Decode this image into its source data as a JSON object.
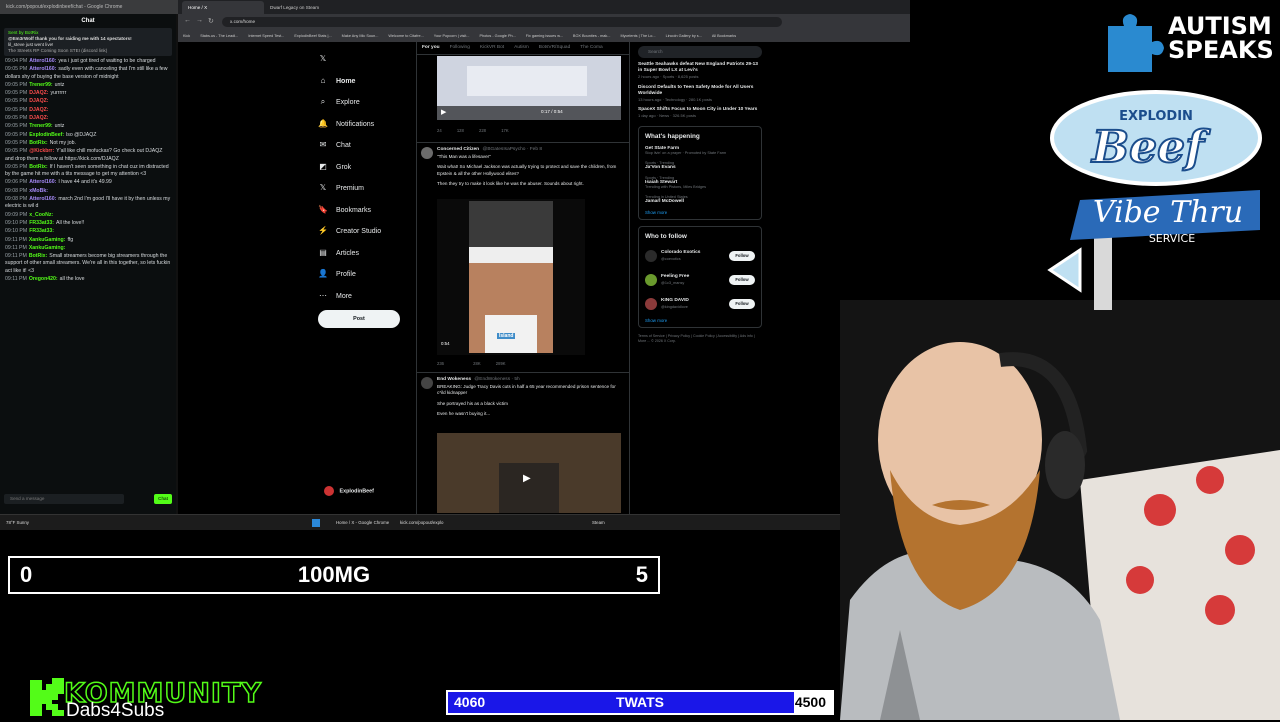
{
  "browser_left": {
    "title": "kick.com/popout/explodinbeef/chat - Google Chrome"
  },
  "chat": {
    "header": "Chat",
    "pinned_lines": [
      "Sent by BotRix",
      "@Em3rWolf thank you for raiding me with 14 spectators!",
      "lil_steve just went live!",
      "The Streets RP Coming Soon STEI (discord link)"
    ],
    "messages": [
      {
        "time": "09:04 PM",
        "user": "Atterol160:",
        "color": "#a78bfa",
        "text": "yea i just got tired of waiting to be charged"
      },
      {
        "time": "09:05 PM",
        "user": "Atterol160:",
        "color": "#a78bfa",
        "text": "sadly even with canceling that I'm still like a few dollars shy of buying the base version of midnight"
      },
      {
        "time": "09:05 PM",
        "user": "Trener99:",
        "color": "#53fc18",
        "text": "untz"
      },
      {
        "time": "09:05 PM",
        "user": "DJAQZ:",
        "color": "#ff4d4d",
        "text": "yurrrrrr"
      },
      {
        "time": "09:05 PM",
        "user": "DJAQZ:",
        "color": "#ff4d4d",
        "text": ""
      },
      {
        "time": "09:05 PM",
        "user": "DJAQZ:",
        "color": "#ff4d4d",
        "text": ""
      },
      {
        "time": "09:05 PM",
        "user": "DJAQZ:",
        "color": "#ff4d4d",
        "text": ""
      },
      {
        "time": "09:05 PM",
        "user": "Trener99:",
        "color": "#53fc18",
        "text": "untz"
      },
      {
        "time": "09:05 PM",
        "user": "ExplodinBeef:",
        "color": "#53fc18",
        "text": "lso @DJAQZ"
      },
      {
        "time": "09:05 PM",
        "user": "BotRix:",
        "color": "#53fc18",
        "text": "Not my job."
      },
      {
        "time": "09:05 PM",
        "user": "@Kickbrr:",
        "color": "#ff4d4d",
        "text": "Y'all like chill mofuckas? Go check out DJAQZ and drop them a follow at https://kick.com/DJAQZ"
      },
      {
        "time": "09:05 PM",
        "user": "BotRix:",
        "color": "#53fc18",
        "text": "If I haven't seen something in chat cuz im distracted by the game hit me with a tits message to get my attention <3"
      },
      {
        "time": "09:06 PM",
        "user": "Atterol160:",
        "color": "#a78bfa",
        "text": "I have 44 and it's 49.99"
      },
      {
        "time": "09:08 PM",
        "user": "xMoBk:",
        "color": "#a78bfa",
        "text": ""
      },
      {
        "time": "09:08 PM",
        "user": "Atterol160:",
        "color": "#a78bfa",
        "text": "march 2nd I'm good I'll have it by then unless my electric is wil d"
      },
      {
        "time": "09:09 PM",
        "user": "x_CooNz:",
        "color": "#53fc18",
        "text": ""
      },
      {
        "time": "09:10 PM",
        "user": "FR33at33:",
        "color": "#53fc18",
        "text": "All the love!!"
      },
      {
        "time": "09:10 PM",
        "user": "FR33at33:",
        "color": "#53fc18",
        "text": ""
      },
      {
        "time": "09:11 PM",
        "user": "XankuGaming:",
        "color": "#53fc18",
        "text": "ffg"
      },
      {
        "time": "09:11 PM",
        "user": "XankuGaming:",
        "color": "#53fc18",
        "text": ""
      },
      {
        "time": "09:11 PM",
        "user": "BotRix:",
        "color": "#53fc18",
        "text": "Small streamers become big streamers through the support of other small streamers. We're all in this together, so lets fuckin act like it! <3"
      },
      {
        "time": "09:11 PM",
        "user": "Oregon420:",
        "color": "#53fc18",
        "text": "all the love"
      }
    ],
    "input_placeholder": "Send a message",
    "send_label": "Chat"
  },
  "browser": {
    "tabs": [
      "Home / X",
      "Dwarf Legacy on Steam"
    ],
    "url": "x.com/home",
    "bookmarks": [
      "Kick",
      "Stabs.us - The Leadi...",
      "Internet Speed Test...",
      "ExplodinBeef Stats |...",
      "Make Any Mic Soun...",
      "Welcome to Citafre...",
      "Your Popcorn | visit...",
      "Photos - Google Ph...",
      "Fix gaming issues w...",
      "BOX Bounties - mak...",
      "Mycelents | The Lo...",
      "Lincoln Gallery by s...",
      "All Bookmarks"
    ]
  },
  "x_nav": {
    "items": [
      {
        "icon": "x-logo-icon",
        "label": ""
      },
      {
        "icon": "home-icon",
        "label": "Home"
      },
      {
        "icon": "search-icon",
        "label": "Explore"
      },
      {
        "icon": "bell-icon",
        "label": "Notifications"
      },
      {
        "icon": "chat-icon",
        "label": "Chat"
      },
      {
        "icon": "grok-icon",
        "label": "Grok"
      },
      {
        "icon": "x-premium-icon",
        "label": "Premium"
      },
      {
        "icon": "bookmark-icon",
        "label": "Bookmarks"
      },
      {
        "icon": "lightning-icon",
        "label": "Creator Studio"
      },
      {
        "icon": "articles-icon",
        "label": "Articles"
      },
      {
        "icon": "person-icon",
        "label": "Profile"
      },
      {
        "icon": "more-icon",
        "label": "More"
      }
    ],
    "post_label": "Post",
    "profile_name": "ExplodinBeef",
    "profile_handle": "@ExplodinBeef"
  },
  "feed": {
    "tabs": [
      "For you",
      "Following",
      "KickVR Bot",
      "Autism",
      "BotsVR/Squad",
      "The Coma"
    ],
    "video1": {
      "time": "0:17 / 0:54",
      "stats": [
        "24",
        "128",
        "228",
        "17K"
      ]
    },
    "post1": {
      "name": "Concerned Citizen",
      "handle": "@BGatesIsaPsycho · Feb 8",
      "text1": "\"This Man was a lifesaver\"",
      "text2": "Wait what! So Michael Jackson was actually trying to protect and save the children, from Epstein & all the other Hollywood elites?",
      "text3": "Then they try to make it look like he was the abuser. Sounds about right.",
      "duration": "0:54",
      "caption": "Island",
      "stats": [
        "236",
        "",
        "28K",
        "289K"
      ]
    },
    "post2": {
      "name": "End Wokeness",
      "handle": "@EndWokeness · 5h",
      "text1": "BREAKING: Judge Tracy Davis cuts in half a 65 year recommended prison sentence for c*ild kidnapper",
      "text2": "She portrayed his as a black victim",
      "text3": "Even he wasn't buying it..."
    }
  },
  "right_col": {
    "search_placeholder": "Search",
    "news": [
      {
        "title": "Seattle Seahawks defeat New England Patriots 29-13 in Super Bowl LX at Levi's",
        "meta": "2 hours ago · Sports · 8,625 posts"
      },
      {
        "title": "Discord Defaults to Teen Safety Mode for All Users Worldwide",
        "meta": "13 hours ago · Technology · 280.1K posts"
      },
      {
        "title": "SpaceX Shifts Focus to Moon City in Under 10 Years",
        "meta": "1 day ago · News · 326.5K posts"
      }
    ],
    "whats_happening_title": "What's happening",
    "trends": [
      {
        "cat": "",
        "name": "Get State Farm",
        "sub": "Stop livin' on a prayer · Promoted by State Farm"
      },
      {
        "cat": "Sports · Trending",
        "name": "Ja'Von Evans",
        "sub": ""
      },
      {
        "cat": "Sports · Trending",
        "name": "Isaiah Stewart",
        "sub": "Trending with Pistons, Miles Bridges"
      },
      {
        "cat": "Trending in United States",
        "name": "Jamarl McDowell",
        "sub": ""
      }
    ],
    "show_more": "Show more",
    "who_to_follow_title": "Who to follow",
    "follow": [
      {
        "name": "Colorado Exotics",
        "handle": "@coexotics",
        "color": "#2b2b2b"
      },
      {
        "name": "Feeling Free",
        "handle": "@1c3_mansy",
        "color": "#6a9a2d"
      },
      {
        "name": "KING DAVID",
        "handle": "@kingdavidlove",
        "color": "#8b3a3a"
      }
    ],
    "follow_label": "Follow",
    "footer": "Terms of Service | Privacy Policy | Cookie Policy | Accessibility | Ads info | More ... © 2026 X Corp."
  },
  "taskbar": {
    "weather": "78°F Sunny",
    "items": [
      "Home / X - Google Chrome",
      "kick.com/popout/explo",
      "Steam"
    ]
  },
  "scorebar": {
    "left": "0",
    "title": "100MG",
    "right": "5"
  },
  "goal": {
    "left": "4060",
    "title": "TWATS",
    "right": "4500",
    "progress": 0.902
  },
  "overlays": {
    "autism_text": "AUTISM SPEAKS",
    "beef_top": "EXPLODIN",
    "beef_word": "Beef",
    "beef_vibe": "Vibe Thru",
    "beef_service": "SERVICE",
    "kommunity": "KOMMUNITY",
    "dabs": "Dabs4Subs"
  },
  "colors": {
    "kick_green": "#53fc18",
    "x_blue": "#1d9bf0",
    "goal_blue": "#1a17e8",
    "autism_blue": "#2a8ad0"
  }
}
